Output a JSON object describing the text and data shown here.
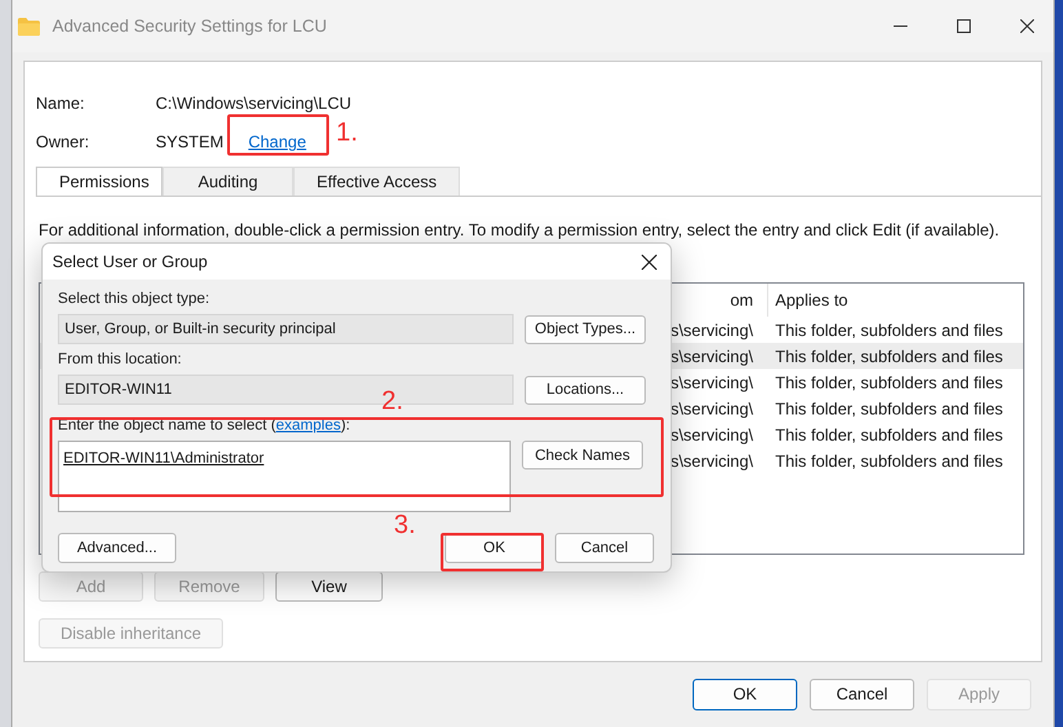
{
  "window": {
    "title": "Advanced Security Settings for LCU"
  },
  "name_row": {
    "label": "Name:",
    "value": "C:\\Windows\\servicing\\LCU"
  },
  "owner_row": {
    "label": "Owner:",
    "value": "SYSTEM",
    "link": "Change"
  },
  "tabs": [
    {
      "label": "Permissions",
      "selected": true
    },
    {
      "label": "Auditing",
      "selected": false
    },
    {
      "label": "Effective Access",
      "selected": false
    }
  ],
  "description": "For additional information, double-click a permission entry. To modify a permission entry, select the entry and click Edit (if available).",
  "permissions_table": {
    "columns": [
      "om",
      "Applies to"
    ],
    "rows": [
      {
        "cells": [
          "s\\servicing\\",
          "This folder, subfolders and files"
        ],
        "selected": false
      },
      {
        "cells": [
          "s\\servicing\\",
          "This folder, subfolders and files"
        ],
        "selected": true
      },
      {
        "cells": [
          "s\\servicing\\",
          "This folder, subfolders and files"
        ],
        "selected": false
      },
      {
        "cells": [
          "s\\servicing\\",
          "This folder, subfolders and files"
        ],
        "selected": false
      },
      {
        "cells": [
          "s\\servicing\\",
          "This folder, subfolders and files"
        ],
        "selected": false
      },
      {
        "cells": [
          "s\\servicing\\",
          "This folder, subfolders and files"
        ],
        "selected": false
      }
    ]
  },
  "entry_buttons": [
    {
      "label": "Add",
      "disabled": true
    },
    {
      "label": "Remove",
      "disabled": true
    },
    {
      "label": "View",
      "disabled": false
    }
  ],
  "inheritance_button": {
    "label": "Disable inheritance",
    "disabled": true
  },
  "footer_buttons": [
    {
      "label": "OK",
      "disabled": false
    },
    {
      "label": "Cancel",
      "disabled": false
    },
    {
      "label": "Apply",
      "disabled": true
    }
  ],
  "dialog": {
    "title": "Select User or Group",
    "object_type": {
      "label": "Select this object type:",
      "value": "User, Group, or Built-in security principal",
      "button": "Object Types..."
    },
    "location": {
      "label": "From this location:",
      "value": "EDITOR-WIN11",
      "button": "Locations..."
    },
    "object_name": {
      "label_before": "Enter the object name to select (",
      "link": "examples",
      "label_after": "):",
      "value": "EDITOR-WIN11\\Administrator",
      "button": "Check Names"
    },
    "advanced_button": "Advanced...",
    "ok_button": "OK",
    "cancel_button": "Cancel"
  },
  "annotations": [
    {
      "label": "1."
    },
    {
      "label": "2."
    },
    {
      "label": "3."
    }
  ]
}
